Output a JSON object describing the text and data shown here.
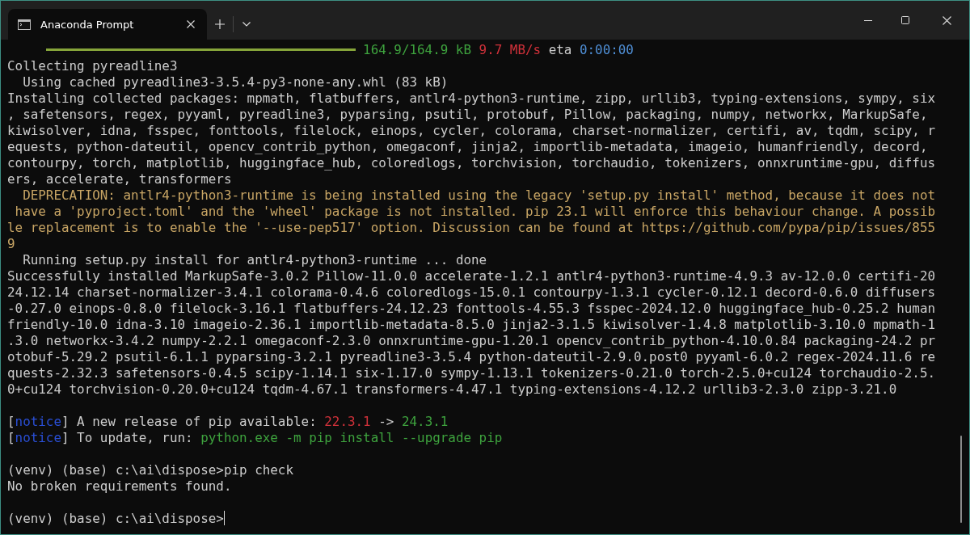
{
  "window": {
    "tab_title": "Anaconda Prompt"
  },
  "terminal": {
    "lines": [
      {
        "kind": "progress",
        "level": 1,
        "segments": [
          {
            "text": "164.9/164.9 kB",
            "color": "#3ea33e"
          },
          {
            "text": " 9.7 MB/s",
            "color": "#d0313a"
          },
          {
            "text": " eta "
          },
          {
            "text": "0:00:00",
            "color": "#4f8fd6"
          }
        ]
      },
      {
        "kind": "text",
        "segments": [
          {
            "text": "Collecting pyreadline3"
          }
        ]
      },
      {
        "kind": "text",
        "segments": [
          {
            "text": "  Using cached pyreadline3-3.5.4-py3-none-any.whl (83 kB)"
          }
        ]
      },
      {
        "kind": "text",
        "segments": [
          {
            "text": "Installing collected packages: mpmath, flatbuffers, antlr4-python3-runtime, zipp, urllib3, typing-extensions, sympy, six"
          }
        ]
      },
      {
        "kind": "text",
        "segments": [
          {
            "text": ", safetensors, regex, pyyaml, pyreadline3, pyparsing, psutil, protobuf, Pillow, packaging, numpy, networkx, MarkupSafe,"
          }
        ]
      },
      {
        "kind": "text",
        "segments": [
          {
            "text": "kiwisolver, idna, fsspec, fonttools, filelock, einops, cycler, colorama, charset-normalizer, certifi, av, tqdm, scipy, r"
          }
        ]
      },
      {
        "kind": "text",
        "segments": [
          {
            "text": "equests, python-dateutil, opencv_contrib_python, omegaconf, jinja2, importlib-metadata, imageio, humanfriendly, decord,"
          }
        ]
      },
      {
        "kind": "text",
        "segments": [
          {
            "text": "contourpy, torch, matplotlib, huggingface_hub, coloredlogs, torchvision, torchaudio, tokenizers, onnxruntime-gpu, diffus"
          }
        ]
      },
      {
        "kind": "text",
        "segments": [
          {
            "text": "ers, accelerate, transformers"
          }
        ]
      },
      {
        "kind": "text",
        "segments": [
          {
            "text": "  DEPRECATION: antlr4-python3-runtime is being installed using the legacy 'setup.py install' method, because it does not",
            "color": "#c9a665"
          }
        ]
      },
      {
        "kind": "text",
        "segments": [
          {
            "text": " have a 'pyproject.toml' and the 'wheel' package is not installed. pip 23.1 will enforce this behaviour change. A possib",
            "color": "#c9a665"
          }
        ]
      },
      {
        "kind": "text",
        "segments": [
          {
            "text": "le replacement is to enable the '--use-pep517' option. Discussion can be found at https://github.com/pypa/pip/issues/855",
            "color": "#c9a665"
          }
        ]
      },
      {
        "kind": "text",
        "segments": [
          {
            "text": "9",
            "color": "#c9a665"
          }
        ]
      },
      {
        "kind": "text",
        "segments": [
          {
            "text": "  Running setup.py install for antlr4-python3-runtime ... done"
          }
        ]
      },
      {
        "kind": "text",
        "segments": [
          {
            "text": "Successfully installed MarkupSafe-3.0.2 Pillow-11.0.0 accelerate-1.2.1 antlr4-python3-runtime-4.9.3 av-12.0.0 certifi-20"
          }
        ]
      },
      {
        "kind": "text",
        "segments": [
          {
            "text": "24.12.14 charset-normalizer-3.4.1 colorama-0.4.6 coloredlogs-15.0.1 contourpy-1.3.1 cycler-0.12.1 decord-0.6.0 diffusers"
          }
        ]
      },
      {
        "kind": "text",
        "segments": [
          {
            "text": "-0.27.0 einops-0.8.0 filelock-3.16.1 flatbuffers-24.12.23 fonttools-4.55.3 fsspec-2024.12.0 huggingface_hub-0.25.2 human"
          }
        ]
      },
      {
        "kind": "text",
        "segments": [
          {
            "text": "friendly-10.0 idna-3.10 imageio-2.36.1 importlib-metadata-8.5.0 jinja2-3.1.5 kiwisolver-1.4.8 matplotlib-3.10.0 mpmath-1"
          }
        ]
      },
      {
        "kind": "text",
        "segments": [
          {
            "text": ".3.0 networkx-3.4.2 numpy-2.2.1 omegaconf-2.3.0 onnxruntime-gpu-1.20.1 opencv_contrib_python-4.10.0.84 packaging-24.2 pr"
          }
        ]
      },
      {
        "kind": "text",
        "segments": [
          {
            "text": "otobuf-5.29.2 psutil-6.1.1 pyparsing-3.2.1 pyreadline3-3.5.4 python-dateutil-2.9.0.post0 pyyaml-6.0.2 regex-2024.11.6 re"
          }
        ]
      },
      {
        "kind": "text",
        "segments": [
          {
            "text": "quests-2.32.3 safetensors-0.4.5 scipy-1.14.1 six-1.17.0 sympy-1.13.1 tokenizers-0.21.0 torch-2.5.0+cu124 torchaudio-2.5."
          }
        ]
      },
      {
        "kind": "text",
        "segments": [
          {
            "text": "0+cu124 torchvision-0.20.0+cu124 tqdm-4.67.1 transformers-4.47.1 typing-extensions-4.12.2 urllib3-2.3.0 zipp-3.21.0"
          }
        ]
      },
      {
        "kind": "blank"
      },
      {
        "kind": "text",
        "segments": [
          {
            "text": "["
          },
          {
            "text": "notice",
            "color": "#2a4fd6"
          },
          {
            "text": "] A new release of pip available: "
          },
          {
            "text": "22.3.1",
            "color": "#d0313a"
          },
          {
            "text": " -> "
          },
          {
            "text": "24.3.1",
            "color": "#3ea33e"
          }
        ]
      },
      {
        "kind": "text",
        "segments": [
          {
            "text": "["
          },
          {
            "text": "notice",
            "color": "#2a4fd6"
          },
          {
            "text": "] To update, run: "
          },
          {
            "text": "python.exe -m pip install --upgrade pip",
            "color": "#3ea33e"
          }
        ]
      },
      {
        "kind": "blank"
      },
      {
        "kind": "text",
        "segments": [
          {
            "text": "(venv) (base) c:\\ai\\dispose>pip check"
          }
        ]
      },
      {
        "kind": "text",
        "segments": [
          {
            "text": "No broken requirements found."
          }
        ]
      },
      {
        "kind": "blank"
      },
      {
        "kind": "text",
        "cursor": true,
        "segments": [
          {
            "text": "(venv) (base) c:\\ai\\dispose>"
          }
        ]
      }
    ]
  }
}
